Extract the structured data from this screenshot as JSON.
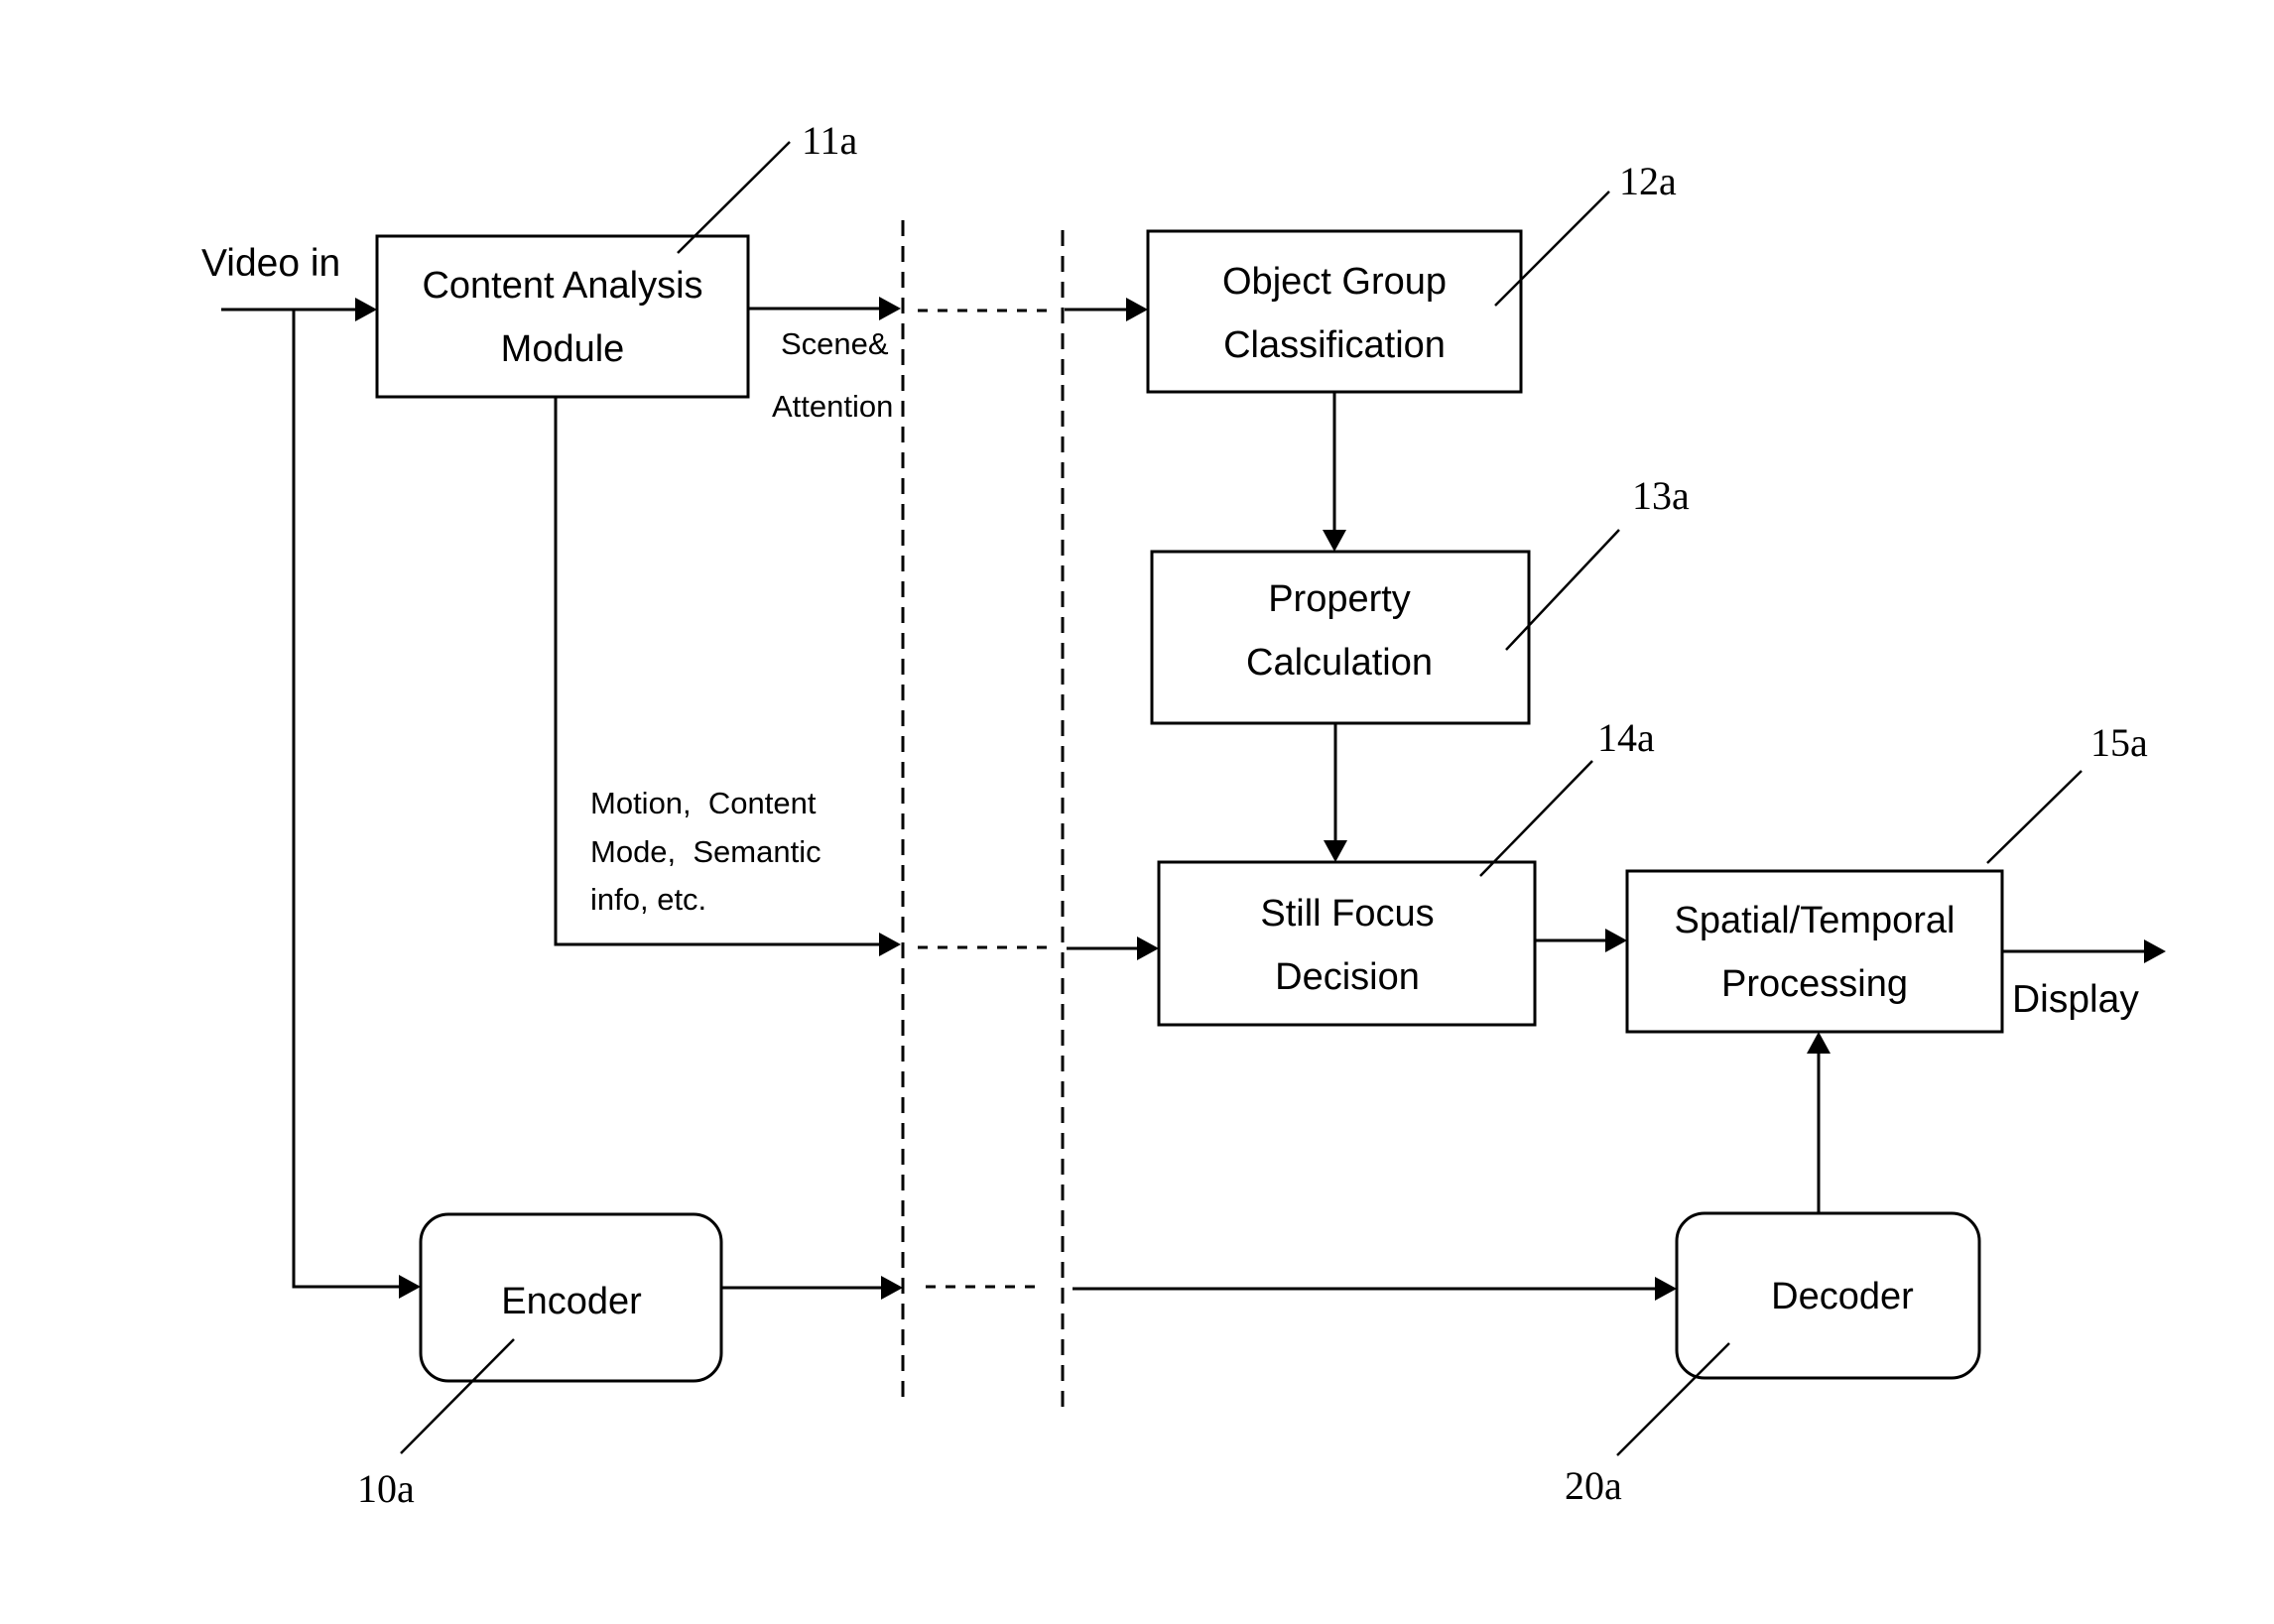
{
  "diagram": {
    "input_label": "Video in",
    "output_label": "Display",
    "blocks": {
      "content_analysis": {
        "lines": [
          "Content Analysis",
          "Module"
        ],
        "ref": "11a"
      },
      "object_group": {
        "lines": [
          "Object Group",
          "Classification"
        ],
        "ref": "12a"
      },
      "property_calc": {
        "lines": [
          "Property",
          "Calculation"
        ],
        "ref": "13a"
      },
      "still_focus": {
        "lines": [
          "Still Focus",
          "Decision"
        ],
        "ref": "14a"
      },
      "spatial_temporal": {
        "lines": [
          "Spatial/Temporal",
          "Processing"
        ],
        "ref": "15a"
      },
      "encoder": {
        "lines": [
          "Encoder"
        ],
        "ref": "10a"
      },
      "decoder": {
        "lines": [
          "Decoder"
        ],
        "ref": "20a"
      }
    },
    "edge_labels": {
      "scene_attention": [
        "Scene&",
        "Attention"
      ],
      "metadata": [
        "Motion,  Content",
        "Mode,  Semantic",
        "info, etc."
      ]
    },
    "edges": [
      {
        "from": "input",
        "to": "content_analysis"
      },
      {
        "from": "input",
        "to": "encoder"
      },
      {
        "from": "content_analysis",
        "to": "object_group",
        "label": "Scene& Attention"
      },
      {
        "from": "content_analysis",
        "to": "still_focus",
        "label": "Motion, Content Mode, Semantic info, etc."
      },
      {
        "from": "object_group",
        "to": "property_calc"
      },
      {
        "from": "property_calc",
        "to": "still_focus"
      },
      {
        "from": "still_focus",
        "to": "spatial_temporal"
      },
      {
        "from": "encoder",
        "to": "decoder"
      },
      {
        "from": "decoder",
        "to": "spatial_temporal"
      },
      {
        "from": "spatial_temporal",
        "to": "output"
      }
    ]
  }
}
